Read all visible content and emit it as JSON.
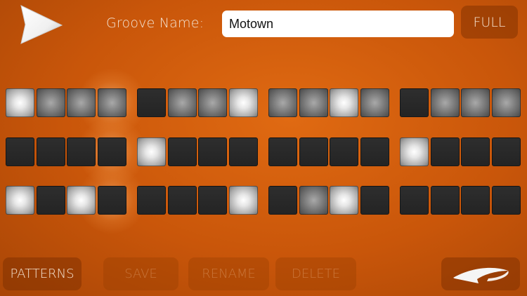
{
  "header": {
    "groove_label": "Groove Name:",
    "groove_value": "Motown",
    "full_label": "FULL"
  },
  "footer": {
    "patterns_label": "PATTERNS",
    "save_label": "SAVE",
    "rename_label": "RENAME",
    "delete_label": "DELETE"
  },
  "icons": {
    "play": "play-icon",
    "back": "back-arrow-icon"
  },
  "colors": {
    "background": "#d4600d",
    "pad_off": "#262626",
    "pad_mid": "#8a8a8a",
    "pad_on": "#f2f2f2"
  },
  "sequencer": {
    "note": "pad levels: 0=off, 1=medium, 2=bright",
    "rows": [
      [
        2,
        1,
        1,
        1,
        0,
        1,
        1,
        2,
        1,
        1,
        2,
        1,
        0,
        1,
        1,
        1
      ],
      [
        0,
        0,
        0,
        0,
        2,
        0,
        0,
        0,
        0,
        0,
        0,
        0,
        2,
        0,
        0,
        0
      ],
      [
        2,
        0,
        2,
        0,
        0,
        0,
        0,
        2,
        0,
        1,
        2,
        0,
        0,
        0,
        0,
        0
      ]
    ],
    "playhead_step": 3
  }
}
